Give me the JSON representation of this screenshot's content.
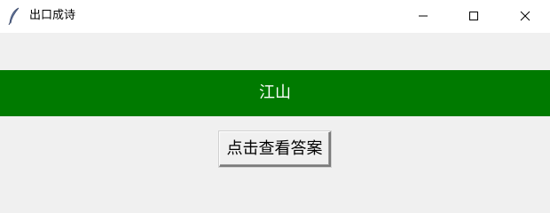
{
  "window": {
    "title": "出口成诗",
    "controls": {
      "minimize_icon": "minimize-icon",
      "maximize_icon": "maximize-icon",
      "close_icon": "close-icon"
    },
    "app_icon": "feather-icon"
  },
  "banner": {
    "text": "江山",
    "background_color": "#007a00",
    "text_color": "#ffffff"
  },
  "answer_button": {
    "label": "点击查看答案"
  }
}
